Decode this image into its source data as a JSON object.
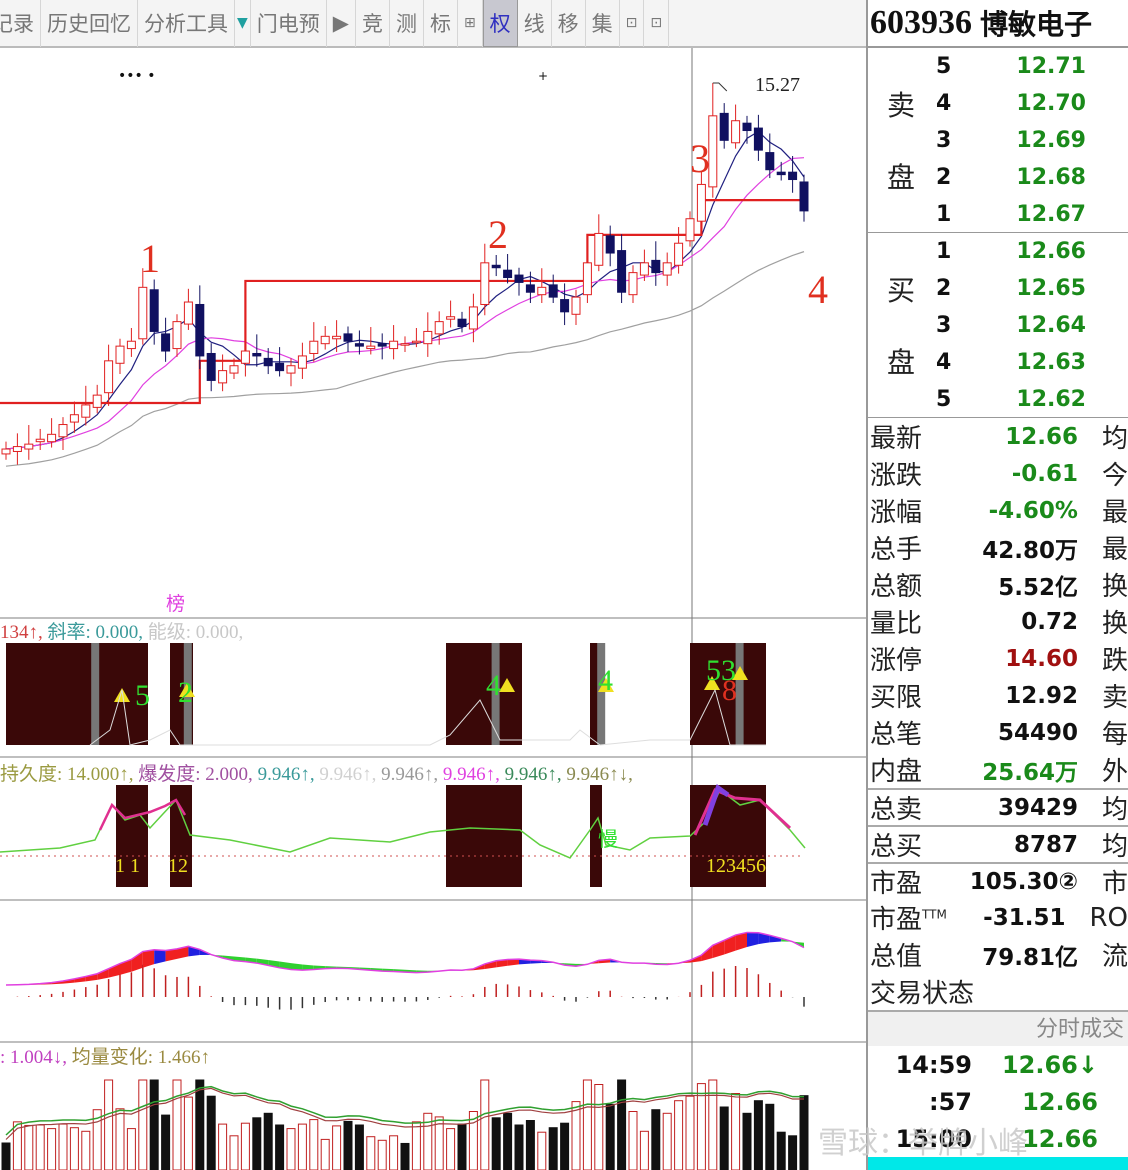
{
  "toolbar": {
    "items": [
      {
        "label": "记录",
        "kind": "text"
      },
      {
        "label": "历史回忆",
        "kind": "text"
      },
      {
        "label": "分析工具",
        "kind": "text"
      },
      {
        "label": "▼",
        "kind": "dropdown"
      },
      {
        "label": "门电预",
        "kind": "text"
      },
      {
        "label": "▶",
        "kind": "text"
      },
      {
        "label": "竞",
        "kind": "text"
      },
      {
        "label": "测",
        "kind": "text"
      },
      {
        "label": "标",
        "kind": "text"
      },
      {
        "label": "⊞",
        "kind": "small"
      },
      {
        "label": "权",
        "kind": "active"
      },
      {
        "label": "线",
        "kind": "text"
      },
      {
        "label": "移",
        "kind": "text"
      },
      {
        "label": "集",
        "kind": "text"
      },
      {
        "label": "⊡",
        "kind": "small"
      },
      {
        "label": "⊡",
        "kind": "small"
      }
    ]
  },
  "stock": {
    "code": "603936",
    "name": "博敏电子"
  },
  "orderbook": {
    "sell_label": [
      "卖",
      "盘"
    ],
    "buy_label": [
      "买",
      "盘"
    ],
    "sell": [
      {
        "level": "5",
        "price": "12.71"
      },
      {
        "level": "4",
        "price": "12.70"
      },
      {
        "level": "3",
        "price": "12.69"
      },
      {
        "level": "2",
        "price": "12.68"
      },
      {
        "level": "1",
        "price": "12.67"
      }
    ],
    "buy": [
      {
        "level": "1",
        "price": "12.66"
      },
      {
        "level": "2",
        "price": "12.65"
      },
      {
        "level": "3",
        "price": "12.64"
      },
      {
        "level": "4",
        "price": "12.63"
      },
      {
        "level": "5",
        "price": "12.62"
      }
    ]
  },
  "stats": [
    {
      "label": "最新",
      "value": "12.66",
      "color": "green",
      "right": "均"
    },
    {
      "label": "涨跌",
      "value": "-0.61",
      "color": "green",
      "right": "今"
    },
    {
      "label": "涨幅",
      "value": "-4.60%",
      "color": "green",
      "right": "最"
    },
    {
      "label": "总手",
      "value": "42.80万",
      "color": "",
      "right": "最"
    },
    {
      "label": "总额",
      "value": "5.52亿",
      "color": "",
      "right": "换"
    },
    {
      "label": "量比",
      "value": "0.72",
      "color": "",
      "right": "换"
    },
    {
      "label": "涨停",
      "value": "14.60",
      "color": "red",
      "right": "跌"
    },
    {
      "label": "买限",
      "value": "12.92",
      "color": "",
      "right": "卖"
    },
    {
      "label": "总笔",
      "value": "54490",
      "color": "",
      "right": "每"
    },
    {
      "label": "内盘",
      "value": "25.64万",
      "color": "green",
      "right": "外"
    },
    {
      "label": "总卖",
      "value": "39429",
      "color": "",
      "right": "均",
      "sep": true
    },
    {
      "label": "总买",
      "value": "8787",
      "color": "",
      "right": "均",
      "sep": true
    },
    {
      "label": "市盈",
      "value": "105.30②",
      "color": "",
      "right": "市",
      "sep": true
    },
    {
      "label": "市盈",
      "sup": "TTM",
      "value": "-31.51",
      "color": "",
      "right": "RO"
    },
    {
      "label": "总值",
      "value": "79.81亿",
      "color": "",
      "right": "流"
    },
    {
      "label": "交易状态",
      "value": "",
      "color": "",
      "right": ""
    }
  ],
  "ticks": {
    "header": "分时成交",
    "rows": [
      {
        "time": "14:59",
        "price": "12.66↓"
      },
      {
        "time": ":57",
        "price": "12.66"
      },
      {
        "time": "15:00",
        "price": "12.66"
      }
    ]
  },
  "watermark": "雪球：举牌小峰",
  "indicators": {
    "panel2": {
      "tag": "榜",
      "parts": [
        {
          "t": "134↑, ",
          "c": "#d04040"
        },
        {
          "t": "斜率: 0.000, ",
          "c": "#3a9a9a"
        },
        {
          "t": "能级: 0.000,",
          "c": "#c8c8c8"
        }
      ]
    },
    "panel3": {
      "parts": [
        {
          "t": "持久度: 14.000↑, ",
          "c": "#9a9a40"
        },
        {
          "t": "爆发度: 2.000, ",
          "c": "#a050a0"
        },
        {
          "t": "9.946↑, ",
          "c": "#3a9a9a"
        },
        {
          "t": "9.946↑, ",
          "c": "#d0d0d0"
        },
        {
          "t": "9.946↑, ",
          "c": "#999"
        },
        {
          "t": "9.946↑, ",
          "c": "#e040e0"
        },
        {
          "t": "9.946↑, ",
          "c": "#3a8a5a"
        },
        {
          "t": "9.946↑↓,",
          "c": "#8a8a50"
        }
      ]
    },
    "volume": {
      "parts": [
        {
          "t": ": 1.004↓, ",
          "c": "#c040c0"
        },
        {
          "t": "均量变化: 1.466↑",
          "c": "#9a8a40"
        }
      ]
    },
    "panel2_marks": [
      "5",
      "2",
      "4",
      "4",
      "53",
      "8"
    ],
    "panel3_marks": [
      "1  1",
      "12",
      "123456",
      "慢"
    ]
  },
  "chart_data": {
    "type": "candlestick",
    "high_label": "15.27",
    "annotations": [
      "1",
      "2",
      "3",
      "4"
    ],
    "close": [
      7.8,
      7.85,
      7.9,
      8.0,
      8.1,
      8.3,
      8.5,
      8.7,
      8.9,
      9.6,
      9.9,
      10.0,
      11.1,
      10.2,
      9.8,
      10.4,
      10.8,
      9.7,
      9.2,
      9.4,
      9.5,
      9.8,
      9.7,
      9.5,
      9.4,
      9.5,
      9.7,
      10.0,
      10.1,
      10.1,
      10.0,
      9.9,
      9.9,
      9.9,
      10.0,
      9.95,
      10.0,
      10.2,
      10.4,
      10.5,
      10.3,
      10.7,
      11.6,
      11.5,
      11.3,
      11.2,
      11.0,
      11.1,
      10.9,
      10.6,
      10.9,
      11.6,
      12.2,
      11.8,
      11.0,
      11.4,
      11.6,
      11.4,
      11.6,
      12.0,
      12.5,
      13.2,
      14.6,
      14.1,
      14.5,
      14.3,
      13.9,
      13.5,
      13.4,
      13.3,
      12.66
    ],
    "support_steps": [
      {
        "from": 0,
        "to": 17,
        "value": 8.74
      },
      {
        "from": 17,
        "to": 21,
        "value": 9.6
      },
      {
        "from": 21,
        "to": 51,
        "value": 11.23
      },
      {
        "from": 51,
        "to": 61,
        "value": 12.17
      },
      {
        "from": 61,
        "to": 70,
        "value": 12.88
      }
    ],
    "price_range": [
      7.0,
      16.0
    ],
    "colors": {
      "up": "#e02020",
      "down": "#101060",
      "ma5": "#202080",
      "ma10": "#e040e0",
      "ma30": "#a0a0a0",
      "support": "#e02020"
    }
  }
}
